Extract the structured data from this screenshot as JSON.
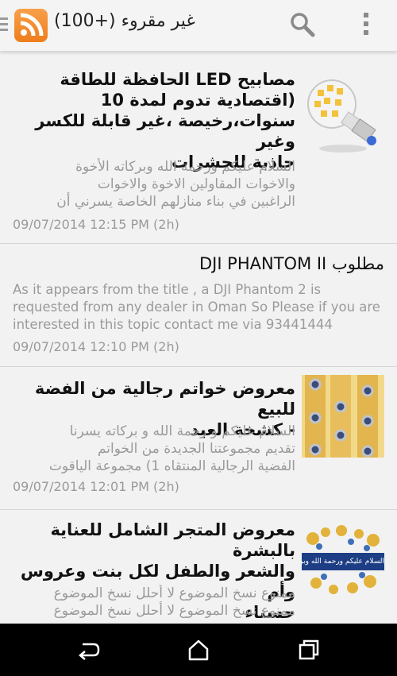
{
  "header": {
    "title": "غير مقروء (+100)",
    "icons": [
      "nav-drawer-icon",
      "rss-icon",
      "search-icon",
      "overflow-menu-icon"
    ]
  },
  "articles": [
    {
      "title_lines": [
        "مصابيح LED الحافظة للطاقة",
        "(اقتصادية تدوم لمدة 10",
        "سنوات،رخيصة ،غير قابلة للكسر وغير",
        "جاذبة للحشرات"
      ],
      "snippet_lines": [
        "السلام عليكم ورحمة الله وبركاته الأخوة",
        "والاخوات المقاولين الاخوة والاخوات",
        "الراغبين في بناء منازلهم الخاصة يسرني أن"
      ],
      "date": "09/07/2014 12:15 PM (2h)",
      "thumbnail": "led-bulb-image"
    },
    {
      "title": "مطلوب DJI PHANTOM II",
      "snippet_lines": [
        "As it appears from the title , a DJI Phantom 2 is",
        "requested from any dealer in Oman So Please if you are",
        "interested in this topic contact me via 93441444"
      ],
      "date": "09/07/2014 12:10 PM (2h)"
    },
    {
      "title_lines": [
        "معروض خواتم رجالية من الفضة للبيع",
        "- كشخة العيد"
      ],
      "snippet_lines": [
        "السلام عليكم و رحمة الله و بركاته يسرنا",
        "تقديم مجموعتنا الجديدة من الخواتم",
        "الفضية الرجالية المنتقاه 1) مجموعة الياقوت"
      ],
      "date": "09/07/2014 12:01 PM (2h)",
      "thumbnail": "silver-rings-image"
    },
    {
      "title_lines": [
        "معروض المتجر الشامل للعناية بالبشرة",
        "والشعر والطفل لكل بنت وعروس وأم",
        "حسناء"
      ],
      "snippet_lines": [
        "ممنوع نسخ الموضوع لا أحلل نسخ الموضوع",
        "ممنوع نسخ الموضوع لا أحلل نسخ الموضوع"
      ],
      "thumbnail": "greeting-banner-image",
      "thumbnail_text": "السلام عليكم ورحمة الله وبركاته"
    }
  ],
  "navbar": {
    "buttons": [
      "back-icon",
      "home-icon",
      "recent-apps-icon"
    ]
  },
  "colors": {
    "rss_orange": "#f08a2c",
    "background": "#f2f2f2",
    "title_text": "#111111",
    "secondary_text": "#9a9a9a",
    "navbar": "#000000"
  }
}
